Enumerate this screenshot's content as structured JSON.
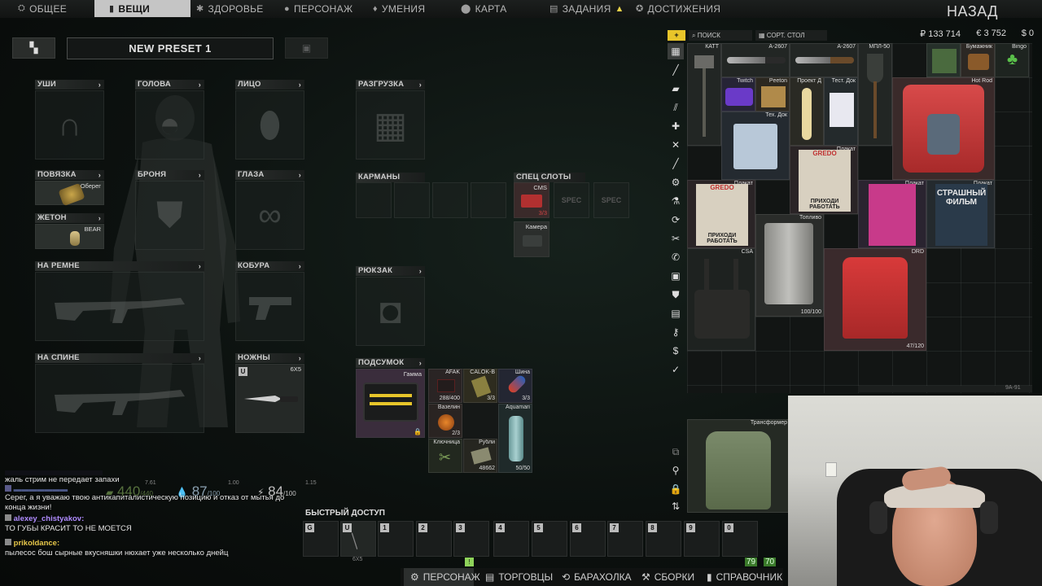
{
  "topnav": {
    "tabs": [
      {
        "label": "ОБЩЕЕ",
        "icon": "steam-icon"
      },
      {
        "label": "ВЕЩИ",
        "icon": "shirt-icon",
        "active": true
      },
      {
        "label": "ЗДОРОВЬЕ",
        "icon": "health-icon"
      },
      {
        "label": "ПЕРСОНАЖ",
        "icon": "character-icon"
      },
      {
        "label": "УМЕНИЯ",
        "icon": "skills-icon"
      },
      {
        "label": "КАРТА",
        "icon": "map-pin-icon"
      },
      {
        "label": "ЗАДАНИЯ",
        "icon": "tasks-icon",
        "warning": true
      },
      {
        "label": "ДОСТИЖЕНИЯ",
        "icon": "achievements-icon"
      }
    ],
    "back_label": "НАЗАД"
  },
  "preset": {
    "name": "NEW PRESET 1"
  },
  "gear_slots": {
    "ears": "УШИ",
    "head": "ГОЛОВА",
    "face": "ЛИЦО",
    "rig": "РАЗГРУЗКА",
    "armband": "ПОВЯЗКА",
    "armor": "БРОНЯ",
    "eyewear": "ГЛАЗА",
    "dogtag": "ЖЕТОН",
    "on_sling": "НА РЕМНЕ",
    "holster": "КОБУРА",
    "on_back": "НА СПИНЕ",
    "scabbard": "НОЖНЫ",
    "pockets": "КАРМАНЫ",
    "special": "СПЕЦ СЛОТЫ",
    "backpack": "РЮКЗАК",
    "pouch": "ПОДСУМОК"
  },
  "equipped": {
    "armband_name": "Оберег",
    "dogtag_name": "BEAR",
    "knife_badge": "U",
    "knife_size": "6X5",
    "special_item_name": "CMS",
    "special_item_count": "3/3",
    "special_placeholder": "SPEC",
    "special_item2_name": "Камера",
    "pouch_name": "Гамма"
  },
  "pouch_items": [
    {
      "name": "AFAK",
      "count": "288/400",
      "count_color": "red"
    },
    {
      "name": "CALOK-B",
      "count": "3/3",
      "count_color": "red"
    },
    {
      "name": "Шина",
      "count": "3/3",
      "count_color": "red"
    },
    {
      "name": "Вазелин",
      "count": "2/3",
      "count_color": "red"
    },
    {
      "name": "Aquamari",
      "count": "50/50",
      "count_color": "red"
    },
    {
      "name": "Ключница",
      "count": ""
    },
    {
      "name": "Рубли",
      "count": "48662",
      "count_color": "green"
    }
  ],
  "stats": {
    "weight_current": "440",
    "weight_max": "/440",
    "weight_sub": "7.61",
    "hydration": "87",
    "hydration_max": "/100",
    "hydration_sub": "1.00",
    "energy": "84",
    "energy_max": "/100",
    "energy_sub": "1.15"
  },
  "stash": {
    "search_label": "ПОИСК",
    "sort_label": "СОРТ. СТОЛ",
    "roubles": "₽ 133 714",
    "euros": "€ 3 752",
    "dollars": "$ 0",
    "items": [
      {
        "name": "КАТТ"
      },
      {
        "name": "А-2607"
      },
      {
        "name": "А-2607"
      },
      {
        "name": "МПЛ-50"
      },
      {
        "name": "Бумажник"
      },
      {
        "name": "Bingo"
      },
      {
        "name": "Twitch"
      },
      {
        "name": "Peeton"
      },
      {
        "name": "Проект Д"
      },
      {
        "name": "Тест. Док"
      },
      {
        "name": "Hot Rod"
      },
      {
        "name": "Тех. Док"
      },
      {
        "name": "Плакат"
      },
      {
        "name": "Плакат"
      },
      {
        "name": "Плакат"
      },
      {
        "name": "Плакат"
      },
      {
        "name": "Топливо",
        "count": "100/100"
      },
      {
        "name": "CSA"
      },
      {
        "name": "DRD",
        "count": "47/120"
      },
      {
        "name": "Трансформер"
      }
    ],
    "poster_texts": {
      "greetings": "ПРИХОДИ РАБОТАТЬ",
      "gredo": "GREDO",
      "scary": "СТРАШНЫЙ ФИЛЬМ"
    },
    "bottom_count": "9A-91"
  },
  "quick_access": {
    "label": "БЫСТРЫЙ ДОСТУП",
    "slots": [
      "G",
      "U",
      "1",
      "2",
      "3",
      "4",
      "5",
      "6",
      "7",
      "8",
      "9",
      "0"
    ],
    "slot2_size": "6X5",
    "weight_left": "79",
    "weight_right": "70"
  },
  "bottom_nav": [
    {
      "label": "ПЕРСОНАЖ",
      "icon": "character-icon",
      "active": true
    },
    {
      "label": "ТОРГОВЦЫ",
      "icon": "traders-icon"
    },
    {
      "label": "БАРАХОЛКА",
      "icon": "flea-market-icon"
    },
    {
      "label": "СБОРКИ",
      "icon": "builds-icon"
    },
    {
      "label": "СПРАВОЧНИК",
      "icon": "handbook-icon"
    }
  ],
  "chat": [
    {
      "user": "",
      "msg": "жаль стрим не передает запахи"
    },
    {
      "user": "",
      "msg": "Серег, а я уважаю твою антикапиталистическую позицию и отказ от мытья до конца жизни!"
    },
    {
      "user": "alexey_chistyakov:",
      "msg": "ТО ГУБЫ КРАСИТ ТО НЕ МОЕТСЯ"
    },
    {
      "user": "prikoldance:",
      "msg": "пылесос бош сырные вкусняшки нюхает уже несколько днейц"
    }
  ],
  "colors": {
    "accent": "#c5c5c5",
    "warning": "#e8d24a",
    "red_count": "#d04444",
    "green_count": "#8ed35a",
    "chat_user": "#b08cff"
  }
}
